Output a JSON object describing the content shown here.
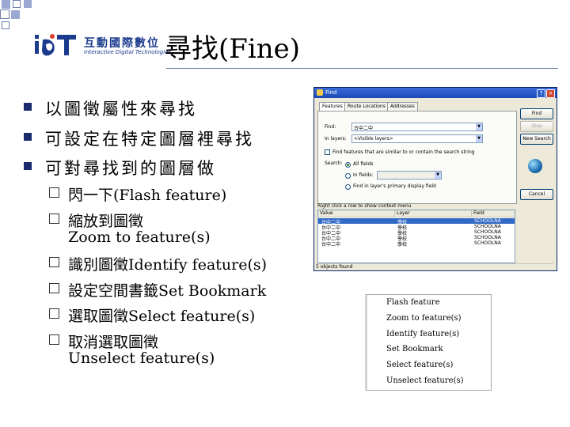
{
  "slide": {
    "title": "尋找(Fine)",
    "logo": {
      "cn": "互動國際數位",
      "en": "Interactive Digital Technologies"
    },
    "bullets": [
      "以圖徵屬性來尋找",
      "可設定在特定圖層裡尋找",
      "可對尋找到的圖層做"
    ],
    "sub_bullets": [
      {
        "text": "閃一下(Flash feature)",
        "cont": ""
      },
      {
        "text": "縮放到圖徵",
        "cont": "Zoom to feature(s)"
      },
      {
        "text": "識別圖徵Identify feature(s)",
        "cont": ""
      },
      {
        "text": "設定空間書籤Set Bookmark",
        "cont": ""
      },
      {
        "text": "選取圖徵Select feature(s)",
        "cont": ""
      },
      {
        "text": "取消選取圖徵",
        "cont": "Unselect feature(s)"
      }
    ]
  },
  "dialog": {
    "title": "Find",
    "tabs": [
      "Features",
      "Route Locations",
      "Addresses"
    ],
    "find_label": "Find:",
    "find_value": "台中二中",
    "in_layers_label": "In layers:",
    "in_layers_value": "<Visible layers>",
    "similar_checkbox": "Find features that are similar to or contain the search string",
    "search_label": "Search:",
    "search_options": [
      "All fields",
      "In fields:",
      "Find in layer's primary display field"
    ],
    "buttons": {
      "find": "Find",
      "stop": "Stop",
      "new_search": "New Search",
      "cancel": "Cancel"
    },
    "results_hint": "Right click a row to show context menu",
    "columns": [
      "Value",
      "Layer",
      "Field"
    ],
    "rows": [
      {
        "value": "台中二中",
        "layer": "學校",
        "field": "SCHOOLNA"
      },
      {
        "value": "台中二中",
        "layer": "學校",
        "field": "SCHOOLNA"
      },
      {
        "value": "台中二中",
        "layer": "學校",
        "field": "SCHOOLNA"
      },
      {
        "value": "台中二中",
        "layer": "學校",
        "field": "SCHOOLNA"
      },
      {
        "value": "台中二中",
        "layer": "學校",
        "field": "SCHOOLNA"
      }
    ],
    "status": "5 objects found"
  },
  "context_menu": {
    "items": [
      "Flash feature",
      "Zoom to feature(s)",
      "Identify feature(s)",
      "Set Bookmark",
      "Select feature(s)",
      "Unselect feature(s)"
    ]
  }
}
